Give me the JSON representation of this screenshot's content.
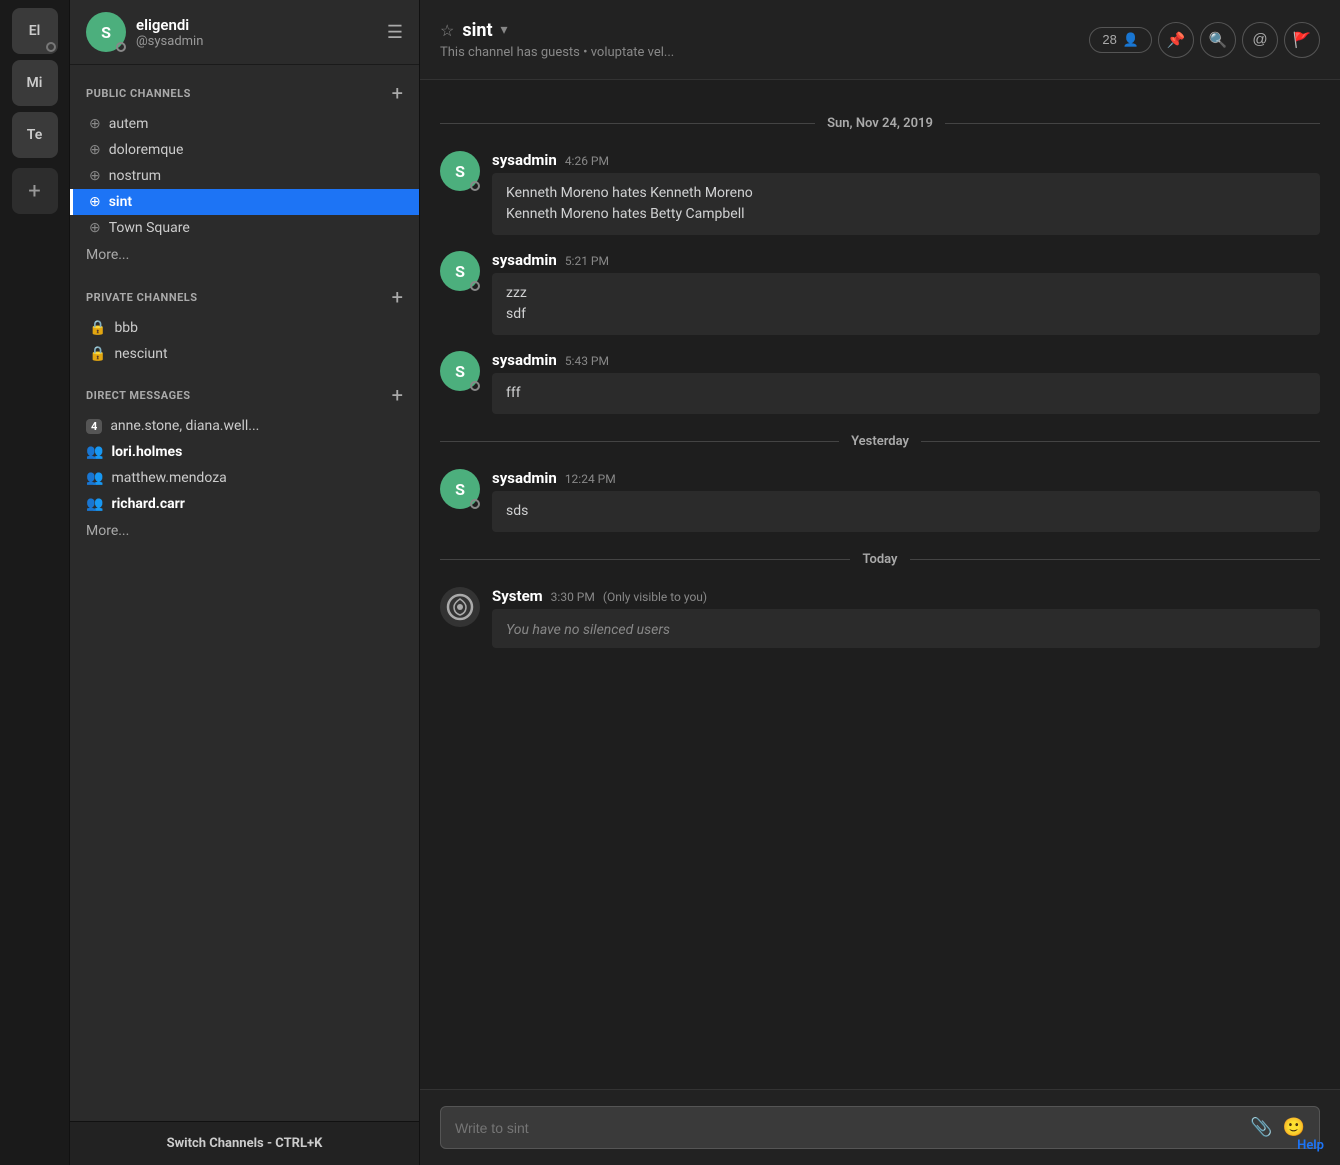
{
  "rail": {
    "items": [
      {
        "label": "El",
        "initials": "El"
      },
      {
        "label": "Mi",
        "initials": "Mi"
      },
      {
        "label": "Te",
        "initials": "Te"
      }
    ],
    "add_label": "+"
  },
  "sidebar": {
    "username": "eligendi",
    "handle": "@sysadmin",
    "avatar_initial": "S",
    "public_channels_label": "PUBLIC CHANNELS",
    "public_channels": [
      {
        "name": "autem",
        "active": false,
        "bold": false
      },
      {
        "name": "doloremque",
        "active": false,
        "bold": false
      },
      {
        "name": "nostrum",
        "active": false,
        "bold": false
      },
      {
        "name": "sint",
        "active": true,
        "bold": false
      },
      {
        "name": "Town Square",
        "active": false,
        "bold": false
      }
    ],
    "public_more": "More...",
    "private_channels_label": "PRIVATE CHANNELS",
    "private_channels": [
      {
        "name": "bbb",
        "active": false,
        "bold": false
      },
      {
        "name": "nesciunt",
        "active": false,
        "bold": false
      }
    ],
    "direct_messages_label": "DIRECT MESSAGES",
    "direct_messages": [
      {
        "name": "anne.stone, diana.well...",
        "bold": false,
        "badge": "4"
      },
      {
        "name": "lori.holmes",
        "bold": true
      },
      {
        "name": "matthew.mendoza",
        "bold": false
      },
      {
        "name": "richard.carr",
        "bold": true
      }
    ],
    "dm_more": "More...",
    "footer": "Switch Channels - CTRL+K"
  },
  "channel": {
    "name": "sint",
    "description": "This channel has guests  •  voluptate vel...",
    "members_count": "28",
    "members_icon": "👤"
  },
  "messages": {
    "date_dividers": [
      "Sun, Nov 24, 2019",
      "Yesterday",
      "Today"
    ],
    "groups": [
      {
        "divider": "Sun, Nov 24, 2019",
        "items": [
          {
            "author": "sysadmin",
            "time": "4:26 PM",
            "lines": [
              "Kenneth Moreno hates Kenneth Moreno",
              "Kenneth Moreno hates Betty Campbell"
            ]
          },
          {
            "author": "sysadmin",
            "time": "5:21 PM",
            "lines": [
              "zzz",
              "sdf"
            ]
          },
          {
            "author": "sysadmin",
            "time": "5:43 PM",
            "lines": [
              "fff"
            ]
          }
        ]
      },
      {
        "divider": "Yesterday",
        "items": [
          {
            "author": "sysadmin",
            "time": "12:24 PM",
            "lines": [
              "sds"
            ]
          }
        ]
      },
      {
        "divider": "Today",
        "items": [
          {
            "author": "System",
            "time": "3:30 PM",
            "system": true,
            "visible_only": "(Only visible to you)",
            "lines": [
              "You have no silenced users"
            ]
          }
        ]
      }
    ]
  },
  "input": {
    "placeholder": "Write to sint"
  },
  "help": "Help"
}
